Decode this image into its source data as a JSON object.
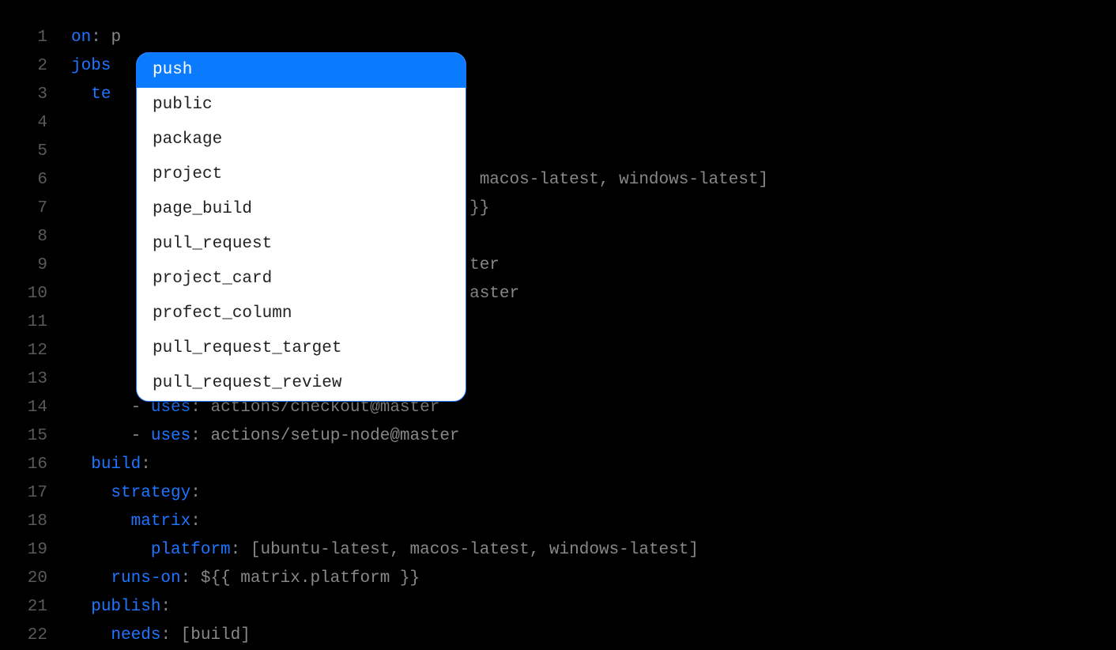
{
  "lineNumbers": [
    "1",
    "2",
    "3",
    "4",
    "5",
    "6",
    "7",
    "8",
    "9",
    "10",
    "11",
    "12",
    "13",
    "14",
    "15",
    "16",
    "17",
    "18",
    "19",
    "20",
    "21",
    "22"
  ],
  "lines": {
    "l1_key": "on",
    "l1_val": "p",
    "l2_key": "jobs",
    "l3_key": "te",
    "l6_val": ", macos-latest, windows-latest]",
    "l7_val": "}}",
    "l9_val": "ter",
    "l10_val": "aster",
    "l14_dash": "- ",
    "l14_key": "uses",
    "l14_val": "actions/checkout@master",
    "l15_dash": "- ",
    "l15_key": "uses",
    "l15_val": "actions/setup-node@master",
    "l16_key": "build",
    "l17_key": "strategy",
    "l18_key": "matrix",
    "l19_key": "platform",
    "l19_val": "[ubuntu-latest, macos-latest, windows-latest]",
    "l20_key": "runs-on",
    "l20_val": "${{ matrix.platform }}",
    "l21_key": "publish",
    "l22_key": "needs",
    "l22_val": "[build]"
  },
  "autocomplete": {
    "selectedIndex": 0,
    "items": [
      "push",
      "public",
      "package",
      "project",
      "page_build",
      "pull_request",
      "project_card",
      "profect_column",
      "pull_request_target",
      "pull_request_review"
    ]
  }
}
